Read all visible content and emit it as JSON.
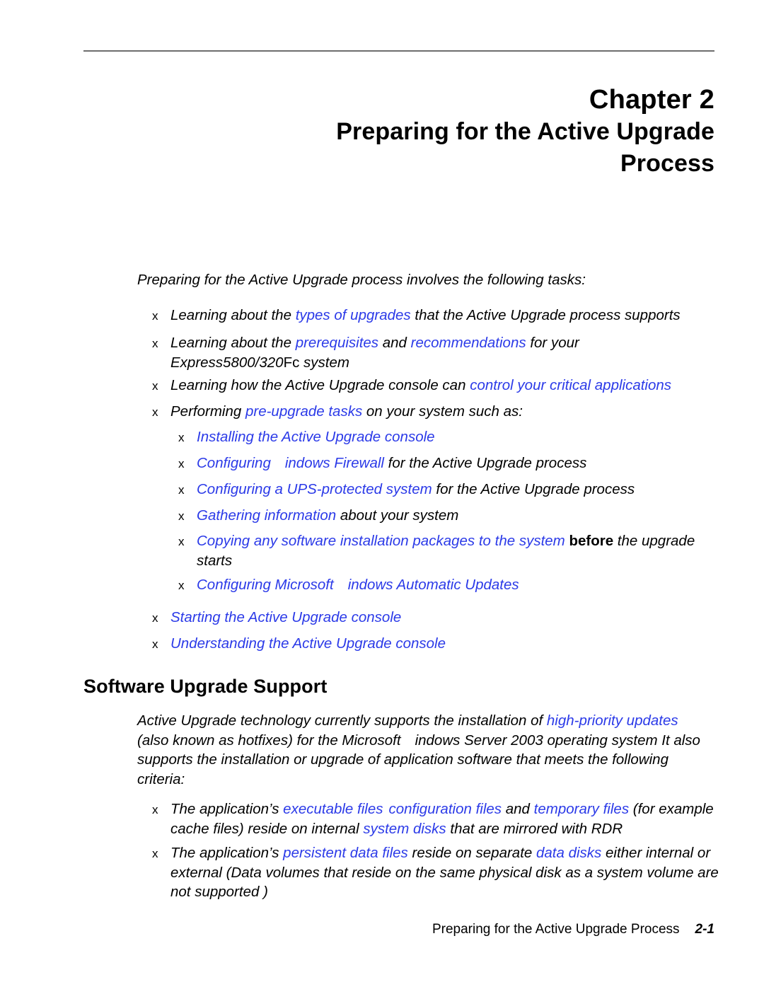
{
  "document": {
    "chapter_number": "Chapter 2",
    "title_line_1": "Preparing for the Active Upgrade",
    "title_line_2": "Process",
    "intro": "Preparing for the Active Upgrade process involves the following tasks:",
    "bullet_marker": "x"
  },
  "task_list": {
    "item1": {
      "pre": "Learning about the ",
      "link": "types of upgrades",
      "post": " that the Active Upgrade process supports"
    },
    "item2": {
      "pre": "Learning about the ",
      "link1": "prerequisites",
      "mid": " and ",
      "link2": "recommendations",
      "post": " for your ",
      "model_italic": "Express5800/320",
      "model_roman": "Fc",
      "post2": " system"
    },
    "item3": {
      "pre": "Learning how the Active Upgrade console can ",
      "link": "control your critical applications"
    },
    "item4": {
      "pre": "Performing ",
      "link": "pre-upgrade tasks",
      "post": " on your system  such as:"
    },
    "sub1": {
      "link": "Installing the Active Upgrade console"
    },
    "sub2": {
      "link1": "Configuring",
      "link2": "indows Firewall",
      "post": " for the Active Upgrade process"
    },
    "sub3": {
      "link": "Configuring a UPS-protected system",
      "post": " for the Active Upgrade process"
    },
    "sub4": {
      "link": "Gathering information",
      "post": " about your system"
    },
    "sub5": {
      "link": "Copying any software installation packages to the system",
      "bold": "before",
      "post": " the upgrade starts"
    },
    "sub6": {
      "link1": "Configuring Microsoft",
      "link2": "indows Automatic Updates"
    },
    "item5": {
      "link": "Starting the Active Upgrade console"
    },
    "item6": {
      "link": "Understanding the Active Upgrade console"
    }
  },
  "section": {
    "heading": "Software Upgrade Support",
    "para_pre": "Active Upgrade technology currently supports the installation of ",
    "para_link": "high-priority updates",
    "para_mid": " (also known as hotfixes) for the Microsoft",
    "para_post": "indows Server 2003 operating system  It also supports the installation or upgrade of application software that meets the following criteria:",
    "criteria1": {
      "pre": "The application’s ",
      "link1": "executable files",
      "gap1": "  ",
      "link2": "configuration files",
      "mid": "  and ",
      "link3": "temporary files",
      "post": " (for example  cache files) reside on internal ",
      "link4": "system disks",
      "tail": " that are mirrored with RDR"
    },
    "criteria2": {
      "pre": "The application’s ",
      "link1": "persistent data files",
      "mid": " reside on separate ",
      "link2": "data disks",
      "post": "  either internal or external  (Data volumes that reside on the same physical disk as a system volume are not supported )"
    }
  },
  "footer": {
    "running_title": "Preparing for the Active Upgrade Process",
    "page_number": "2-1"
  },
  "colors": {
    "link": "#2b3ae8",
    "rule": "#6e6e6e",
    "text": "#000000"
  }
}
